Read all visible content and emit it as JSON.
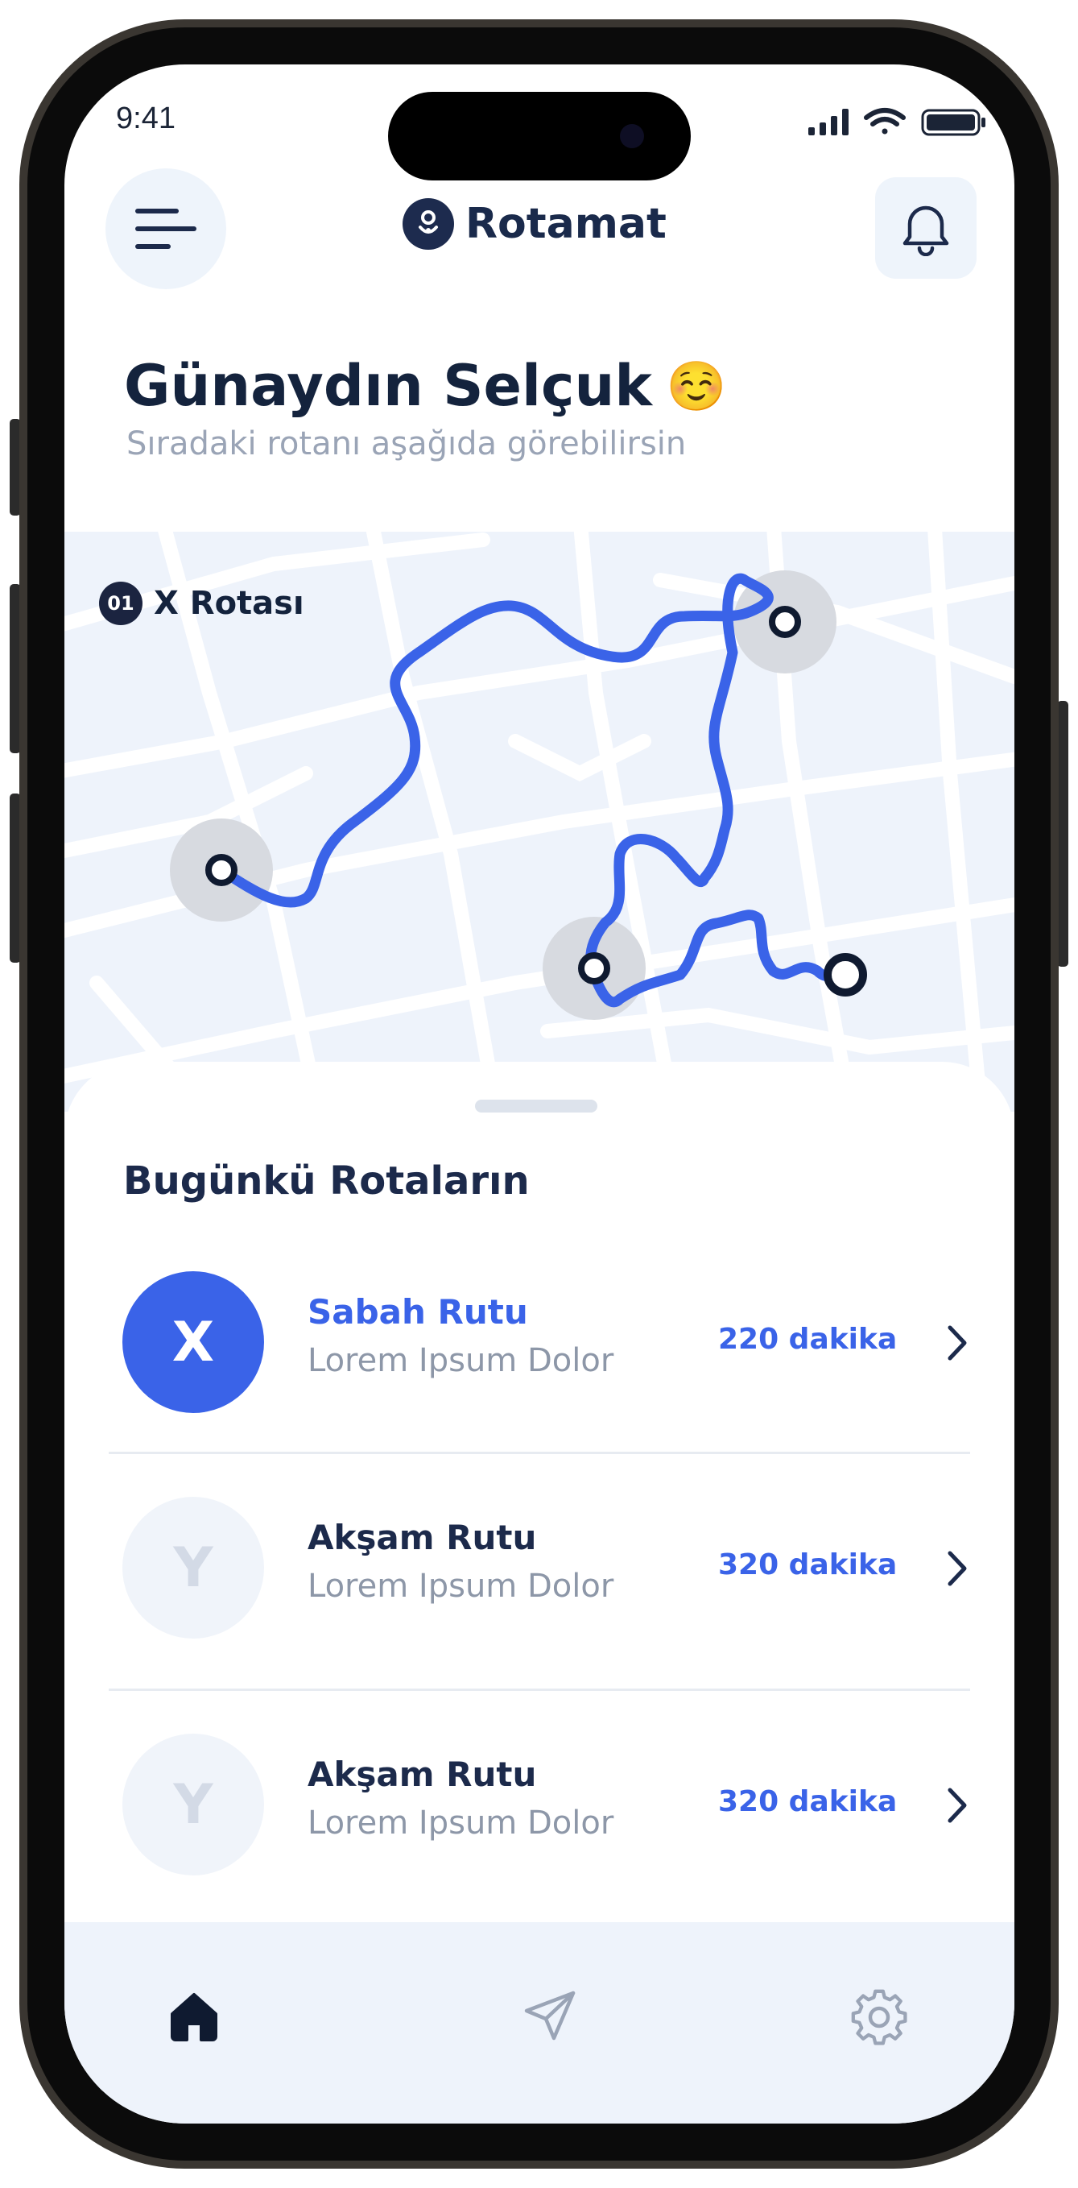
{
  "status_bar": {
    "time": "9:41"
  },
  "header": {
    "app_name": "Rotamat"
  },
  "greeting": {
    "title": "Günaydın Selçuk",
    "emoji": "☺️",
    "subtitle": "Sıradaki rotanı aşağıda görebilirsin"
  },
  "map": {
    "route_number": "01",
    "route_name": "X Rotası"
  },
  "routes_section": {
    "title": "Bugünkü Rotaların",
    "items": [
      {
        "letter": "X",
        "title": "Sabah Rutu",
        "subtitle": "Lorem Ipsum Dolor",
        "duration": "220 dakika",
        "active": true
      },
      {
        "letter": "Y",
        "title": "Akşam Rutu",
        "subtitle": "Lorem Ipsum Dolor",
        "duration": "320 dakika",
        "active": false
      },
      {
        "letter": "Y",
        "title": "Akşam Rutu",
        "subtitle": "Lorem Ipsum Dolor",
        "duration": "320 dakika",
        "active": false
      }
    ]
  },
  "tab_bar": {
    "tabs": [
      {
        "icon": "home-icon",
        "active": true
      },
      {
        "icon": "send-icon",
        "active": false
      },
      {
        "icon": "settings-icon",
        "active": false
      }
    ]
  },
  "colors": {
    "accent": "#3a63e8",
    "navy": "#1c2a4b",
    "muted": "#8d97a8",
    "surface": "#eef3fb"
  }
}
